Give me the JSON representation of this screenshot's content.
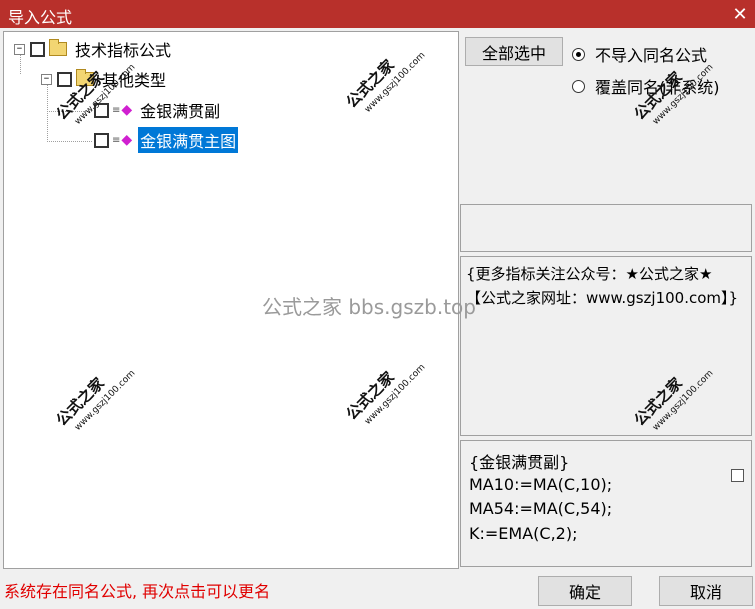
{
  "window": {
    "title": "导入公式",
    "close_glyph": "✕",
    "titlebar_color": "#b8302b"
  },
  "tree": {
    "root": {
      "label": "技术指标公式",
      "expander": "−",
      "icon": "folder-icon"
    },
    "group": {
      "label": "其他类型",
      "expander": "−"
    },
    "items": [
      {
        "label": "金银满贯副",
        "selected": false,
        "icon": "formula-icon"
      },
      {
        "label": "金银满贯主图",
        "selected": true,
        "icon": "formula-icon"
      }
    ],
    "selection_color": "#0078d7"
  },
  "buttons": {
    "select_all": "全部选中",
    "ok": "确定",
    "cancel": "取消"
  },
  "options": {
    "no_import_label": "不导入同名公式",
    "overwrite_label": "覆盖同名(非系统)",
    "selected": "no_import"
  },
  "info_text": "{更多指标关注公众号：★公式之家★ 【公式之家网址：www.gszj100.com】}",
  "code": {
    "lines": [
      "{金银满贯副}",
      "MA10:=MA(C,10);",
      "MA54:=MA(C,54);",
      "K:=EMA(C,2);"
    ]
  },
  "status_text": "系统存在同名公式, 再次点击可以更名",
  "status_color": "#e00000",
  "watermark": {
    "brand": "公式之家",
    "url": "www.gszj100.com",
    "center_text": "公式之家 bbs.gszb.top"
  }
}
